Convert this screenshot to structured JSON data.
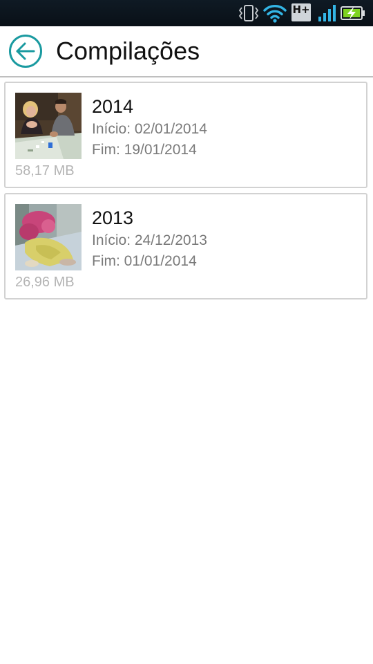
{
  "status_bar": {
    "network_type": "H+",
    "icons": [
      "vibrate-icon",
      "wifi-icon",
      "hplus-icon",
      "signal-icon",
      "battery-charging-icon"
    ],
    "accent_color": "#33b5e5",
    "battery_color": "#7ed321"
  },
  "header": {
    "title": "Compilações",
    "back_icon": "back-arrow-icon",
    "accent_color": "#1a9aa0"
  },
  "compilations": [
    {
      "title": "2014",
      "start": "Início: 02/01/2014",
      "end": "Fim: 19/01/2014",
      "size": "58,17 MB",
      "thumbnail": "photo-thumbnail-people-at-table"
    },
    {
      "title": "2013",
      "start": "Início: 24/12/2013",
      "end": "Fim: 01/01/2014",
      "size": "26,96 MB",
      "thumbnail": "photo-thumbnail-baby-sleeping"
    }
  ]
}
